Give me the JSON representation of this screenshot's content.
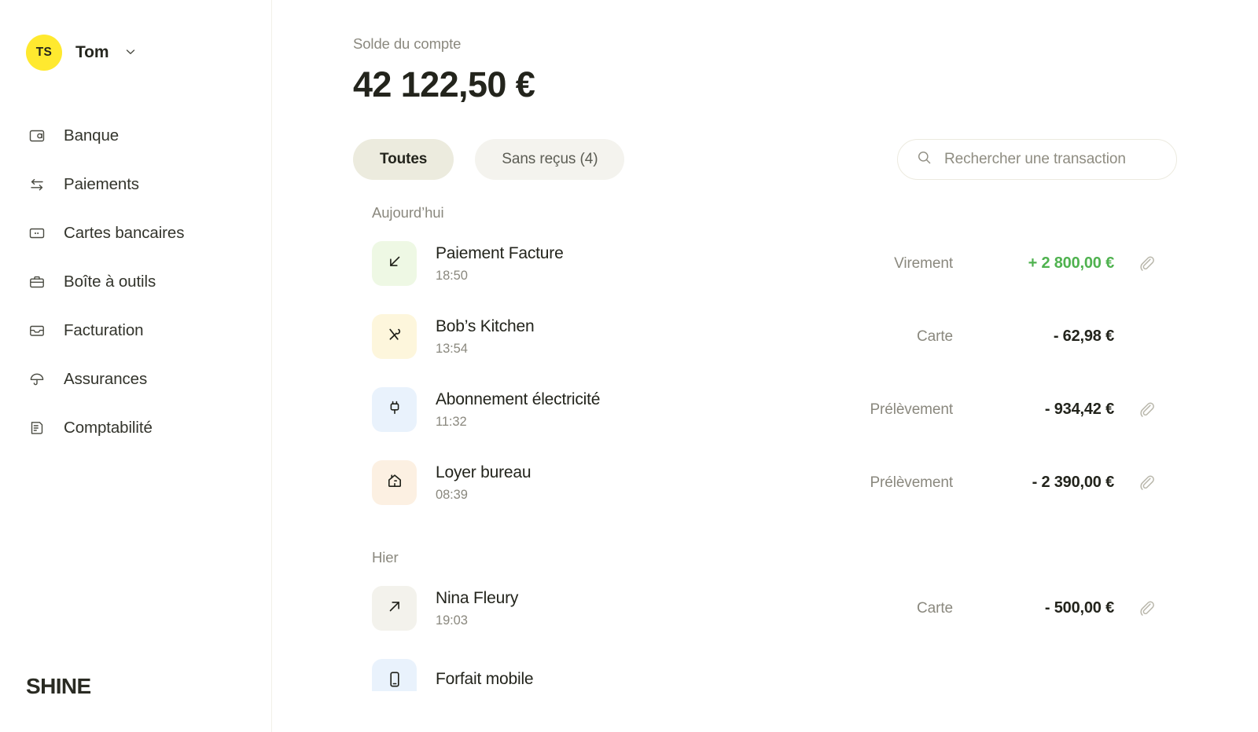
{
  "sidebar": {
    "profile": {
      "initials": "TS",
      "name": "Tom",
      "chevron_icon": "chevron-down-icon"
    },
    "items": [
      {
        "label": "Banque",
        "icon": "wallet-icon"
      },
      {
        "label": "Paiements",
        "icon": "transfer-arrows-icon"
      },
      {
        "label": "Cartes bancaires",
        "icon": "card-icon"
      },
      {
        "label": "Boîte à outils",
        "icon": "briefcase-icon"
      },
      {
        "label": "Facturation",
        "icon": "inbox-icon"
      },
      {
        "label": "Assurances",
        "icon": "umbrella-icon"
      },
      {
        "label": "Comptabilité",
        "icon": "document-icon"
      }
    ],
    "brand": "SHINE"
  },
  "header": {
    "balance_label": "Solde du compte",
    "balance_amount": "42 122,50 €"
  },
  "toolbar": {
    "filters": [
      {
        "label": "Toutes",
        "active": true
      },
      {
        "label": "Sans reçus (4)",
        "active": false
      }
    ],
    "search": {
      "placeholder": "Rechercher une transaction",
      "value": "",
      "icon": "search-icon"
    }
  },
  "transactions": {
    "groups": [
      {
        "day": "Aujourd’hui",
        "rows": [
          {
            "name": "Paiement Facture",
            "time": "18:50",
            "method": "Virement",
            "amount": "+ 2 800,00 €",
            "credit": true,
            "icon": "arrow-down-left-icon",
            "tile_color": "#eef8e4",
            "has_receipt": true
          },
          {
            "name": "Bob’s Kitchen",
            "time": "13:54",
            "method": "Carte",
            "amount": "- 62,98 €",
            "credit": false,
            "icon": "cutlery-icon",
            "tile_color": "#fdf6dc",
            "has_receipt": false
          },
          {
            "name": "Abonnement électricité",
            "time": "11:32",
            "method": "Prélèvement",
            "amount": "- 934,42 €",
            "credit": false,
            "icon": "plug-icon",
            "tile_color": "#e9f2fc",
            "has_receipt": true
          },
          {
            "name": "Loyer bureau",
            "time": "08:39",
            "method": "Prélèvement",
            "amount": "- 2 390,00 €",
            "credit": false,
            "icon": "house-icon",
            "tile_color": "#fcf0e2",
            "has_receipt": true
          }
        ]
      },
      {
        "day": "Hier",
        "rows": [
          {
            "name": "Nina Fleury",
            "time": "19:03",
            "method": "Carte",
            "amount": "- 500,00 €",
            "credit": false,
            "icon": "arrow-up-right-icon",
            "tile_color": "#f3f2ec",
            "has_receipt": true
          },
          {
            "name": "Forfait mobile",
            "time": "",
            "method": "",
            "amount": "",
            "credit": false,
            "icon": "phone-icon",
            "tile_color": "#e9f2fc",
            "has_receipt": false
          }
        ]
      }
    ]
  },
  "colors": {
    "accent_yellow": "#ffe92f",
    "credit_green": "#4fb24f",
    "text_primary": "#23241c",
    "text_muted": "#8a887e",
    "pill_active_bg": "#ecebde",
    "pill_inactive_bg": "#f4f3ee"
  }
}
